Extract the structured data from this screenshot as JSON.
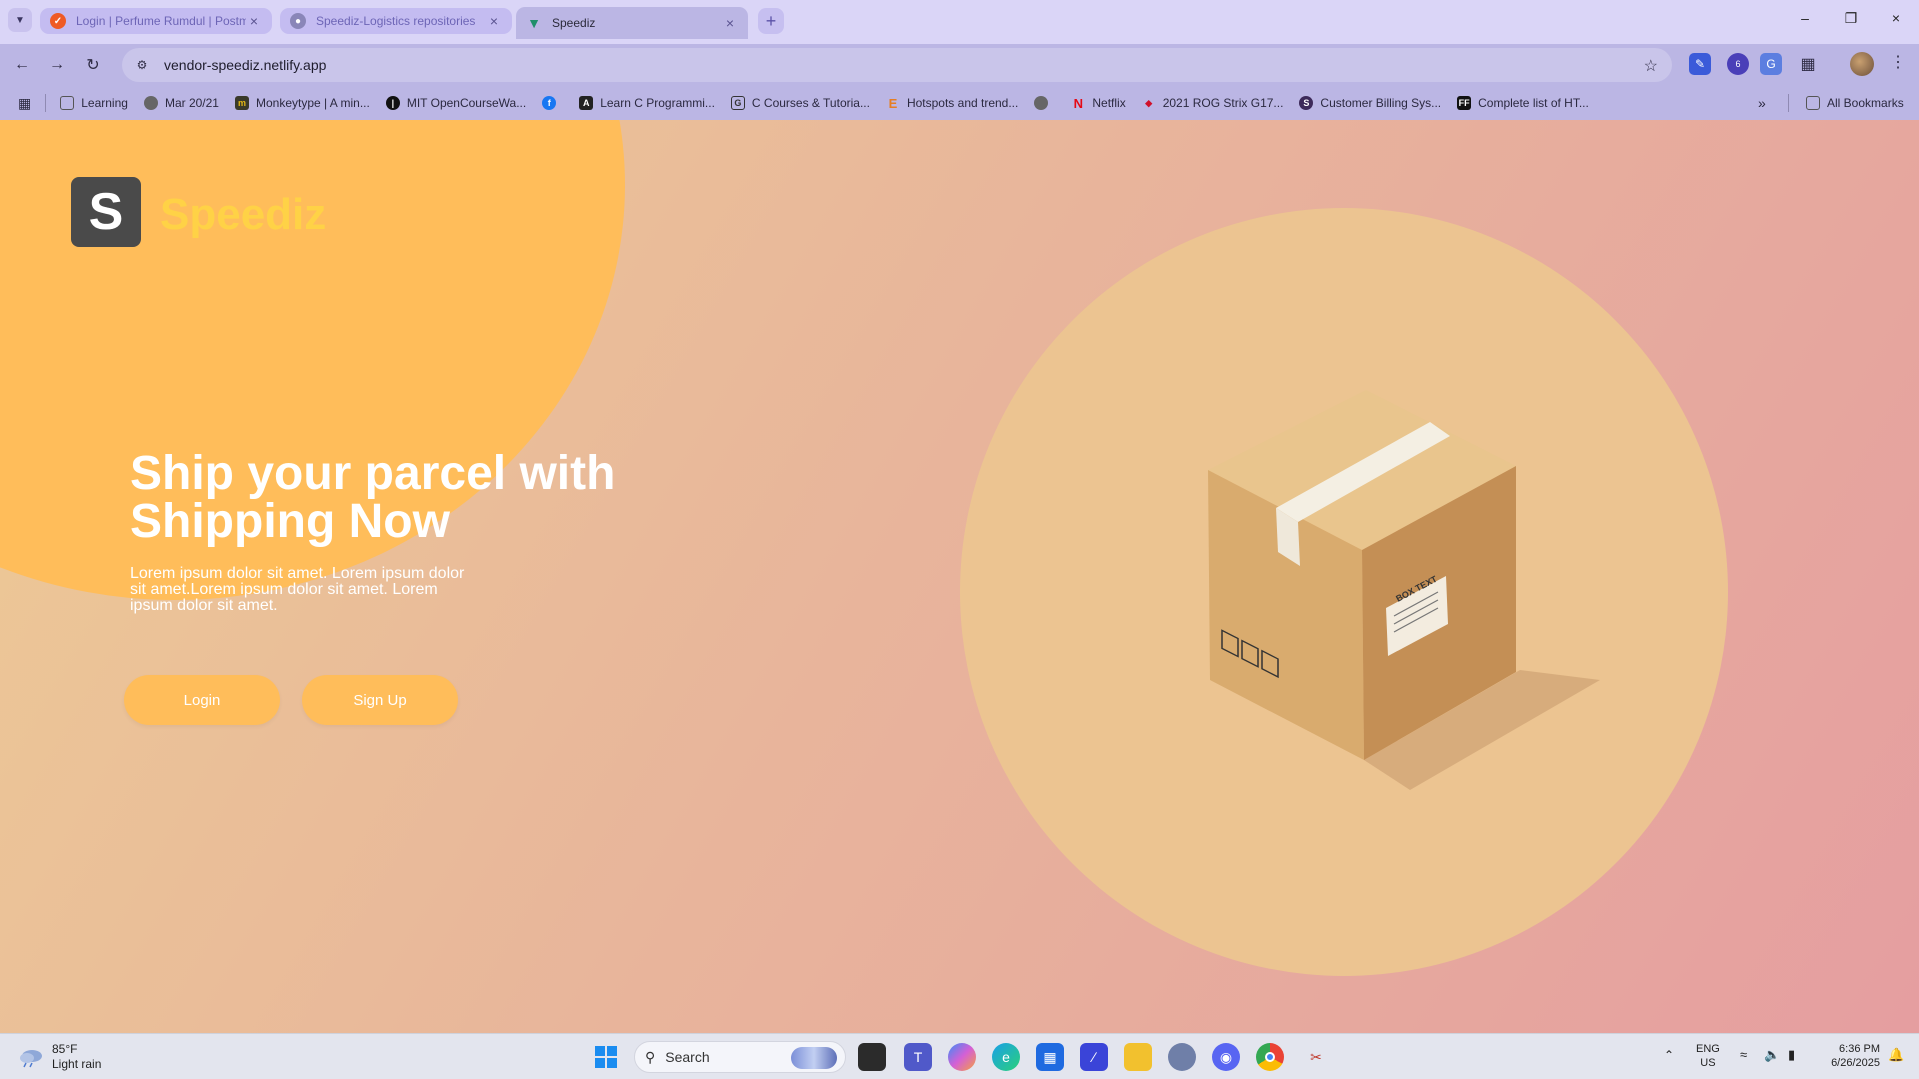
{
  "browser": {
    "tabs": [
      {
        "title": "Login | Perfume Rumdul | Postman",
        "active": false
      },
      {
        "title": "Speediz-Logistics repositories",
        "active": false
      },
      {
        "title": "Speediz",
        "active": true
      }
    ],
    "url": "vendor-speediz.netlify.app",
    "bookmarks": [
      {
        "label": "Learning",
        "icon": "folder-icon"
      },
      {
        "label": "Mar 20/21",
        "icon": "globe-icon"
      },
      {
        "label": "Monkeytype | A min...",
        "icon": "monkeytype-icon"
      },
      {
        "label": "MIT OpenCourseWa...",
        "icon": "mit-icon"
      },
      {
        "label": "",
        "icon": "facebook-icon"
      },
      {
        "label": "Learn C Programmi...",
        "icon": "learn-c-icon"
      },
      {
        "label": "C Courses & Tutoria...",
        "icon": "course-icon"
      },
      {
        "label": "Hotspots and trend...",
        "icon": "e-icon"
      },
      {
        "label": "",
        "icon": "globe-icon"
      },
      {
        "label": "Netflix",
        "icon": "netflix-icon"
      },
      {
        "label": "2021 ROG Strix G17...",
        "icon": "rog-icon"
      },
      {
        "label": "Customer Billing Sys...",
        "icon": "st-icon"
      },
      {
        "label": "Complete list of HT...",
        "icon": "ff-icon"
      }
    ],
    "all_bookmarks": "All Bookmarks",
    "extension_badge": "6"
  },
  "page": {
    "logo_letter": "S",
    "brand": "Speediz",
    "headline": "Ship your parcel with Shipping Now",
    "body": "Lorem ipsum dolor sit amet. Lorem ipsum dolor sit amet.Lorem ipsum dolor sit amet. Lorem ipsum dolor sit amet.",
    "login_label": "Login",
    "signup_label": "Sign Up",
    "box_label": "BOX TEXT",
    "colors": {
      "accent": "#ffbd5a",
      "brand": "#ffd246",
      "logo_bg": "#4a4a4a"
    }
  },
  "taskbar": {
    "weather_temp": "85°F",
    "weather_desc": "Light rain",
    "search_label": "Search",
    "lang_1": "ENG",
    "lang_2": "US",
    "time": "6:36 PM",
    "date": "6/26/2025"
  }
}
